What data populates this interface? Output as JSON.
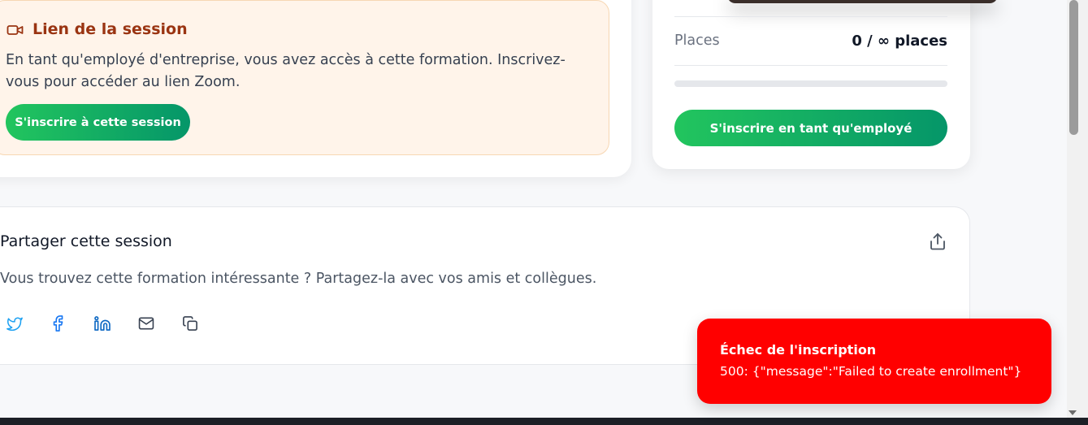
{
  "session_link": {
    "title": "Lien de la session",
    "icon": "video-icon",
    "text": "En tant qu'employé d'entreprise, vous avez accès à cette formation. Inscrivez-vous pour accéder au lien Zoom.",
    "button_label": "S'inscrire à cette session"
  },
  "sidebar": {
    "places_label": "Places",
    "places_value": "0 / ∞ places",
    "progress_fraction": 0,
    "enroll_button_label": "S'inscrire en tant qu'employé"
  },
  "share": {
    "title": "Partager cette session",
    "description": "Vous trouvez cette formation intéressante ? Partagez-la avec vos amis et collègues.",
    "icons": [
      "twitter-icon",
      "facebook-icon",
      "linkedin-icon",
      "mail-icon",
      "copy-icon"
    ]
  },
  "toast": {
    "title": "Échec de l'inscription",
    "message": "500: {\"message\":\"Failed to create enrollment\"}"
  },
  "colors": {
    "accent_green_start": "#22c55e",
    "accent_green_end": "#059669",
    "session_box_bg": "#fff4ea",
    "session_title": "#9a3412",
    "toast_bg": "#ff0000",
    "social_blue": "#0a66c2"
  }
}
